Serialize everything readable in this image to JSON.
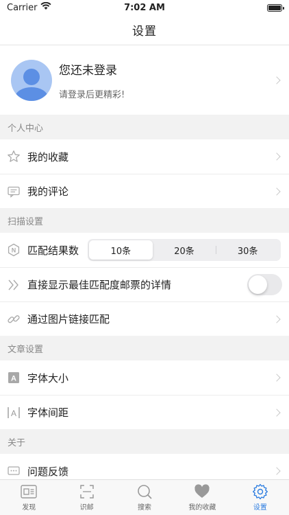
{
  "status": {
    "carrier": "Carrier",
    "time": "7:02 AM"
  },
  "nav": {
    "title": "设置"
  },
  "profile": {
    "name": "您还未登录",
    "subtitle": "请登录后更精彩!"
  },
  "sections": {
    "personal": {
      "header": "个人中心",
      "favorites": "我的收藏",
      "comments": "我的评论"
    },
    "scan": {
      "header": "扫描设置",
      "match_count_label": "匹配结果数",
      "match_options": [
        "10条",
        "20条",
        "30条"
      ],
      "selected_option": "10条",
      "show_best_label": "直接显示最佳匹配度邮票的详情",
      "show_best_enabled": false,
      "link_match_label": "通过图片链接匹配"
    },
    "article": {
      "header": "文章设置",
      "font_size": "字体大小",
      "letter_spacing": "字体间距"
    },
    "about": {
      "header": "关于",
      "feedback": "问题反馈"
    }
  },
  "tabs": [
    "发现",
    "识邮",
    "搜索",
    "我的收藏",
    "设置"
  ],
  "active_tab": "设置",
  "colors": {
    "accent": "#2d7de0",
    "avatar": "#5c8fe4"
  }
}
